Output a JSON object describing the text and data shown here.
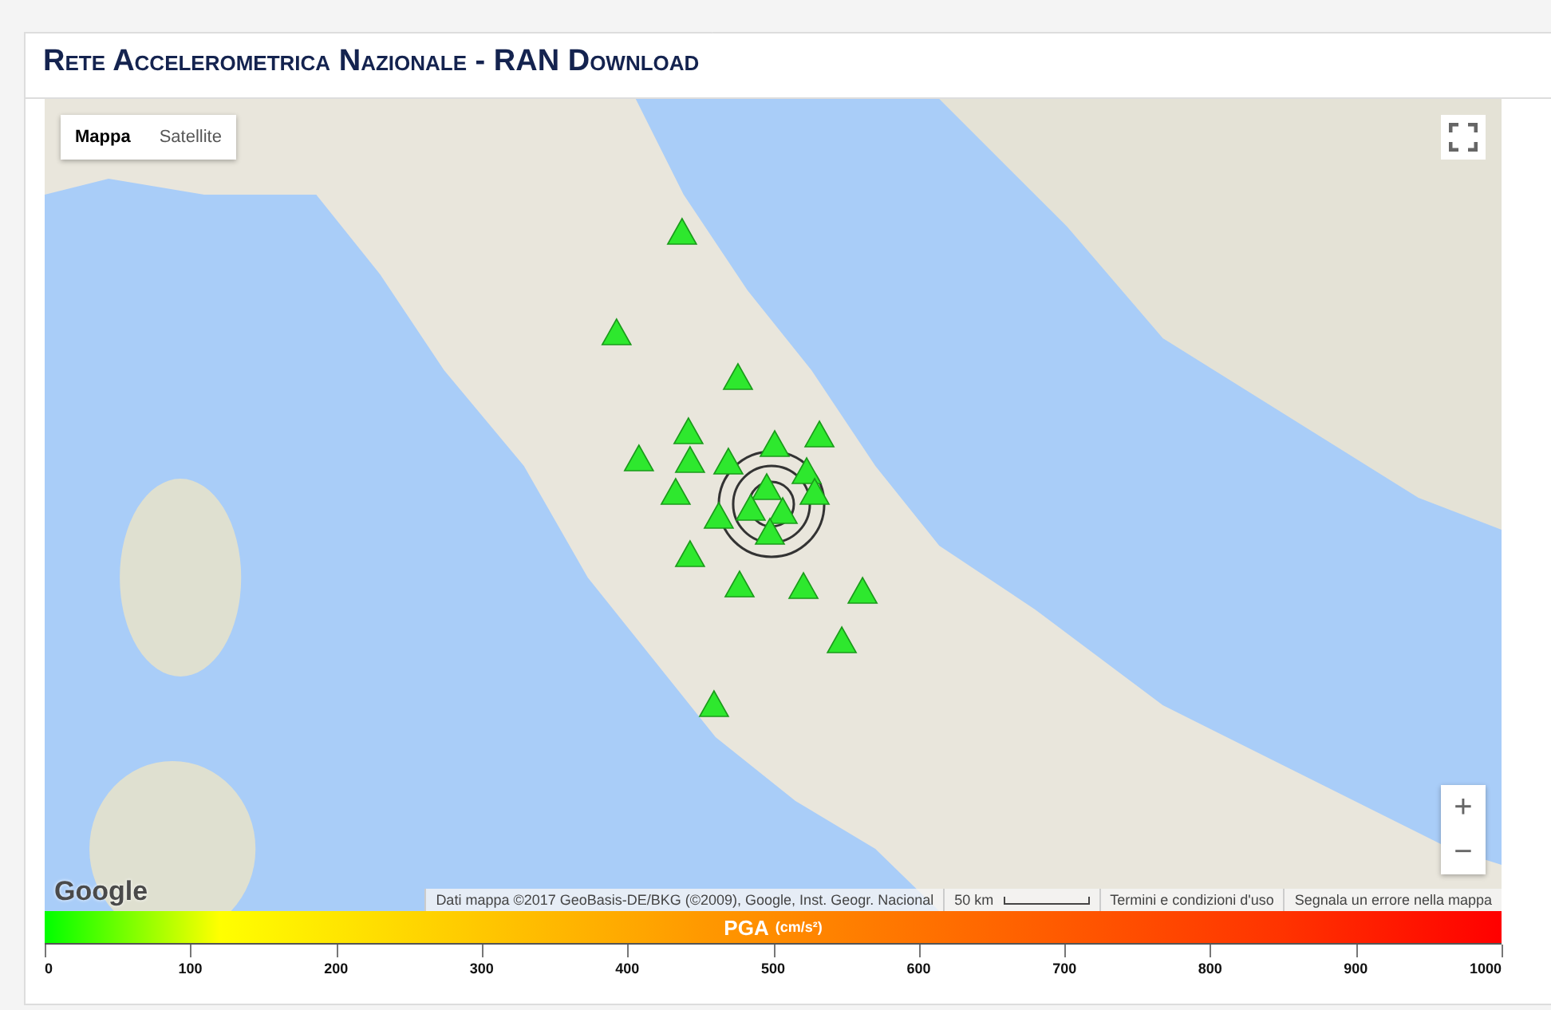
{
  "panel": {
    "title": "Rete Accelerometrica Nazionale - RAN Download"
  },
  "map": {
    "type_tabs": [
      {
        "label": "Mappa",
        "selected": true
      },
      {
        "label": "Satellite",
        "selected": false
      }
    ],
    "zoom_in": "+",
    "zoom_out": "−",
    "logo": "Google",
    "attribution": "Dati mappa ©2017 GeoBasis-DE/BKG (©2009), Google, Inst. Geogr. Nacional",
    "scale": "50 km",
    "terms": "Termini e condizioni d'uso",
    "report": "Segnala un errore nella mappa"
  },
  "legend": {
    "title": "PGA",
    "unit": "(cm/s²)",
    "ticks": [
      "0",
      "100",
      "200",
      "300",
      "400",
      "500",
      "600",
      "700",
      "800",
      "900",
      "1000"
    ]
  }
}
